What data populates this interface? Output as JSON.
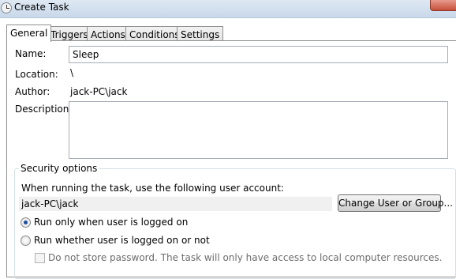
{
  "window": {
    "title": "Create Task",
    "title_icon": "clock-icon",
    "close_icon": "close-icon"
  },
  "tabs": [
    {
      "label": "General",
      "active": true
    },
    {
      "label": "Triggers",
      "active": false
    },
    {
      "label": "Actions",
      "active": false
    },
    {
      "label": "Conditions",
      "active": false
    },
    {
      "label": "Settings",
      "active": false
    }
  ],
  "general": {
    "name_label": "Name:",
    "name_value": "Sleep",
    "location_label": "Location:",
    "location_value": "\\",
    "author_label": "Author:",
    "author_value": "jack-PC\\jack",
    "description_label": "Description:",
    "description_value": ""
  },
  "security": {
    "legend": "Security options",
    "account_prompt": "When running the task, use the following user account:",
    "account_value": "jack-PC\\jack",
    "change_button": "Change User or Group...",
    "radio_logged_on": "Run only when user is logged on",
    "radio_logged_on_checked": true,
    "radio_whether": "Run whether user is logged on or not",
    "radio_whether_checked": false,
    "store_password_label": "Do not store password.  The task will only have access to local computer resources.",
    "store_password_checked": false
  },
  "colors": {
    "radio_dot": "#1c4f9c",
    "titlebar": "#dfe8f3",
    "close_button": "#c7503a"
  }
}
